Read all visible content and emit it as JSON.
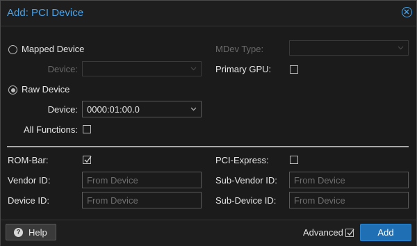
{
  "dialog": {
    "title": "Add: PCI Device"
  },
  "form": {
    "mapped_device_label": "Mapped Device",
    "mapped_device_checked": false,
    "mapped_device_field_label": "Device:",
    "mapped_device_value": "",
    "raw_device_label": "Raw Device",
    "raw_device_checked": true,
    "raw_device_field_label": "Device:",
    "raw_device_value": "0000:01:00.0",
    "all_functions_label": "All Functions:",
    "all_functions_checked": false,
    "mdev_type_label": "MDev Type:",
    "mdev_type_value": "",
    "primary_gpu_label": "Primary GPU:",
    "primary_gpu_checked": false
  },
  "advanced": {
    "rom_bar_label": "ROM-Bar:",
    "rom_bar_checked": true,
    "pci_express_label": "PCI-Express:",
    "pci_express_checked": false,
    "vendor_id_label": "Vendor ID:",
    "vendor_id_placeholder": "From Device",
    "device_id_label": "Device ID:",
    "device_id_placeholder": "From Device",
    "sub_vendor_id_label": "Sub-Vendor ID:",
    "sub_vendor_id_placeholder": "From Device",
    "sub_device_id_label": "Sub-Device ID:",
    "sub_device_id_placeholder": "From Device"
  },
  "footer": {
    "help_label": "Help",
    "advanced_label": "Advanced",
    "advanced_checked": true,
    "add_label": "Add"
  },
  "icons": {
    "close": "close-circle-icon",
    "help": "question-circle-icon",
    "chevron": "chevron-down-icon",
    "check": "checkmark-icon"
  },
  "colors": {
    "accent": "#4aa3e8",
    "primary_button": "#1f6fb4",
    "background": "#1b1b1b"
  }
}
